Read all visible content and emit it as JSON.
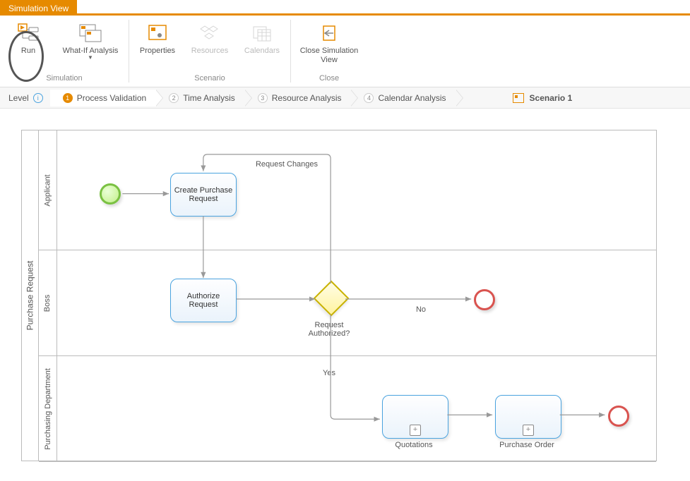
{
  "ribbon": {
    "tab_label": "Simulation View",
    "groups": {
      "simulation": {
        "label": "Simulation",
        "run": "Run",
        "whatif": "What-If Analysis"
      },
      "scenario": {
        "label": "Scenario",
        "properties": "Properties",
        "resources": "Resources",
        "calendars": "Calendars"
      },
      "close": {
        "label": "Close",
        "close": "Close Simulation View"
      }
    }
  },
  "level_bar": {
    "label": "Level",
    "steps": [
      {
        "num": "1",
        "label": "Process Validation",
        "active": true
      },
      {
        "num": "2",
        "label": "Time Analysis",
        "active": false
      },
      {
        "num": "3",
        "label": "Resource Analysis",
        "active": false
      },
      {
        "num": "4",
        "label": "Calendar Analysis",
        "active": false
      }
    ],
    "scenario_label": "Scenario 1"
  },
  "diagram": {
    "pool": "Purchase Request",
    "lanes": {
      "applicant": "Applicant",
      "boss": "Boss",
      "purchasing": "Purchasing Department"
    },
    "tasks": {
      "create": "Create Purchase Request",
      "authorize": "Authorize Request",
      "quotations": "Quotations",
      "purchase_order": "Purchase Order"
    },
    "gateway_label": "Request Authorized?",
    "edge_labels": {
      "request_changes": "Request Changes",
      "no": "No",
      "yes": "Yes"
    }
  },
  "chart_data": {
    "type": "bpmn-process",
    "pool": "Purchase Request",
    "lanes": [
      "Applicant",
      "Boss",
      "Purchasing Department"
    ],
    "nodes": [
      {
        "id": "start",
        "type": "startEvent",
        "lane": "Applicant"
      },
      {
        "id": "create",
        "type": "task",
        "lane": "Applicant",
        "name": "Create Purchase Request"
      },
      {
        "id": "authorize",
        "type": "task",
        "lane": "Boss",
        "name": "Authorize Request"
      },
      {
        "id": "gw",
        "type": "exclusiveGateway",
        "lane": "Boss",
        "name": "Request Authorized?"
      },
      {
        "id": "end_no",
        "type": "endEvent",
        "lane": "Boss"
      },
      {
        "id": "quotations",
        "type": "subprocess",
        "lane": "Purchasing Department",
        "name": "Quotations"
      },
      {
        "id": "po",
        "type": "subprocess",
        "lane": "Purchasing Department",
        "name": "Purchase Order"
      },
      {
        "id": "end_yes",
        "type": "endEvent",
        "lane": "Purchasing Department"
      }
    ],
    "flows": [
      {
        "from": "start",
        "to": "create"
      },
      {
        "from": "create",
        "to": "authorize"
      },
      {
        "from": "authorize",
        "to": "gw"
      },
      {
        "from": "gw",
        "to": "create",
        "label": "Request Changes"
      },
      {
        "from": "gw",
        "to": "end_no",
        "label": "No"
      },
      {
        "from": "gw",
        "to": "quotations",
        "label": "Yes"
      },
      {
        "from": "quotations",
        "to": "po"
      },
      {
        "from": "po",
        "to": "end_yes"
      }
    ]
  }
}
